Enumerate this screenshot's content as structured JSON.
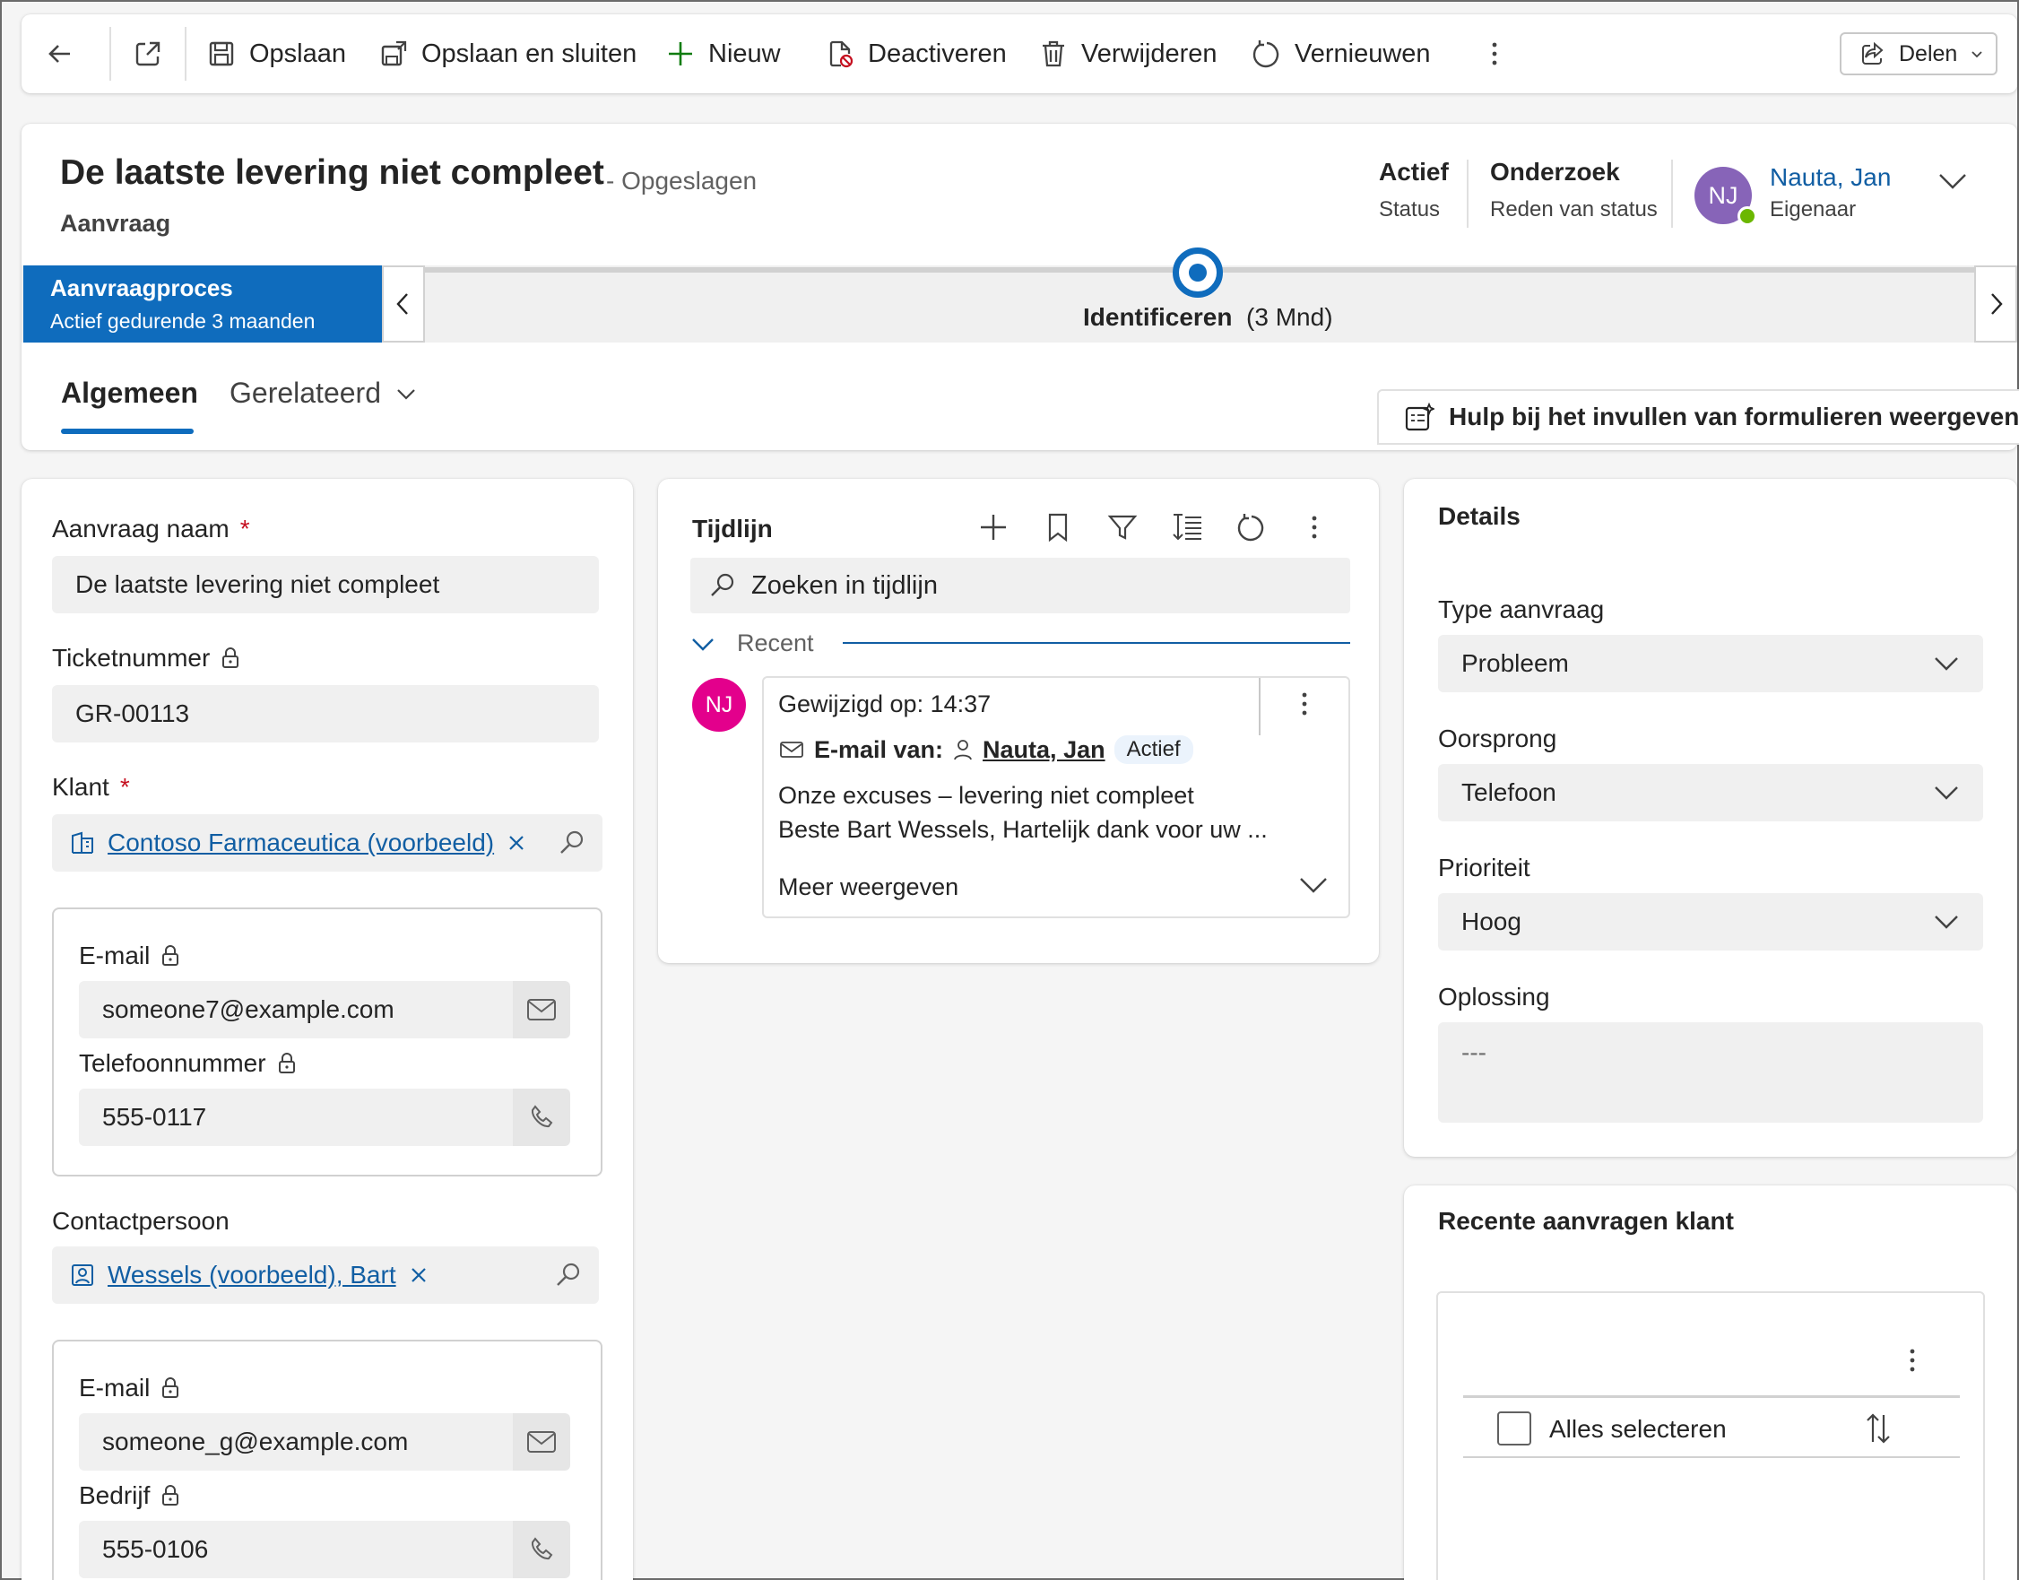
{
  "commandbar": {
    "save": "Opslaan",
    "save_close": "Opslaan en sluiten",
    "new": "Nieuw",
    "deactivate": "Deactiveren",
    "delete": "Verwijderen",
    "refresh": "Vernieuwen",
    "share": "Delen"
  },
  "header": {
    "title": "De laatste levering niet compleet",
    "saved_status": "- Opgeslagen",
    "entity": "Aanvraag",
    "fields": [
      {
        "value": "Actief",
        "label": "Status"
      },
      {
        "value": "Onderzoek",
        "label": "Reden van status"
      }
    ],
    "owner": {
      "initials": "NJ",
      "name": "Nauta, Jan",
      "label": "Eigenaar"
    }
  },
  "bpf": {
    "process_title": "Aanvraagproces",
    "process_sub": "Actief gedurende 3 maanden",
    "stage": "Identificeren",
    "stage_duration": "(3 Mnd)"
  },
  "tabs": {
    "general": "Algemeen",
    "related": "Gerelateerd"
  },
  "help_button": "Hulp bij het invullen van formulieren weergeven",
  "form": {
    "case_name_label": "Aanvraag naam",
    "case_name_value": "De laatste levering niet compleet",
    "ticket_label": "Ticketnummer",
    "ticket_value": "GR-00113",
    "customer_label": "Klant",
    "customer_value": "Contoso Farmaceutica (voorbeeld)",
    "customer_email_label": "E-mail",
    "customer_email": "someone7@example.com",
    "customer_phone_label": "Telefoonnummer",
    "customer_phone": "555-0117",
    "contact_label": "Contactpersoon",
    "contact_value": "Wessels (voorbeeld), Bart",
    "contact_email_label": "E-mail",
    "contact_email": "someone_g@example.com",
    "contact_business_label": "Bedrijf",
    "contact_business": "555-0106"
  },
  "timeline": {
    "title": "Tijdlijn",
    "search_placeholder": "Zoeken in tijdlijn",
    "recent_label": "Recent",
    "item": {
      "avatar": "NJ",
      "modified": "Gewijzigd op: 14:37",
      "from_label": "E-mail van:",
      "from_name": "Nauta, Jan",
      "badge": "Actief",
      "subject": "Onze excuses – levering niet compleet",
      "preview": "Beste Bart Wessels,   Hartelijk dank voor uw ...",
      "show_more": "Meer weergeven"
    }
  },
  "details": {
    "title": "Details",
    "type_label": "Type aanvraag",
    "type_value": "Probleem",
    "origin_label": "Oorsprong",
    "origin_value": "Telefoon",
    "priority_label": "Prioriteit",
    "priority_value": "Hoog",
    "resolution_label": "Oplossing",
    "resolution_value": "---"
  },
  "recent_requests": {
    "title": "Recente aanvragen klant",
    "select_all": "Alles selecteren"
  },
  "colors": {
    "accent": "#0f6cbd",
    "link": "#115ea3",
    "required": "#c50f1f",
    "owner_avatar": "#8764b8",
    "timeline_avatar": "#e3008c",
    "presence": "#6bb700"
  }
}
